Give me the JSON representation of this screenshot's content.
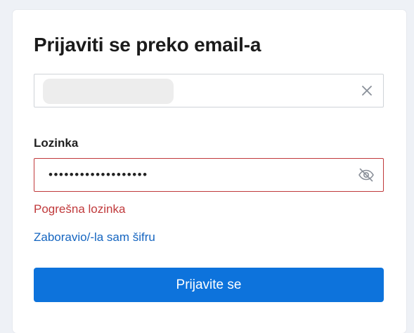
{
  "login": {
    "title": "Prijaviti se preko email-a",
    "email": {
      "value": "",
      "clear_icon": "close-icon"
    },
    "password": {
      "label": "Lozinka",
      "value": "•••••••••••••••••••",
      "toggle_icon": "eye-off-icon"
    },
    "error_text": "Pogrešna lozinka",
    "forgot_link": "Zaboravio/-la sam šifru",
    "submit_label": "Prijavite se"
  },
  "colors": {
    "background": "#eef1f6",
    "error": "#c0393b",
    "link": "#1565c0",
    "primary_button": "#0d73dc"
  }
}
